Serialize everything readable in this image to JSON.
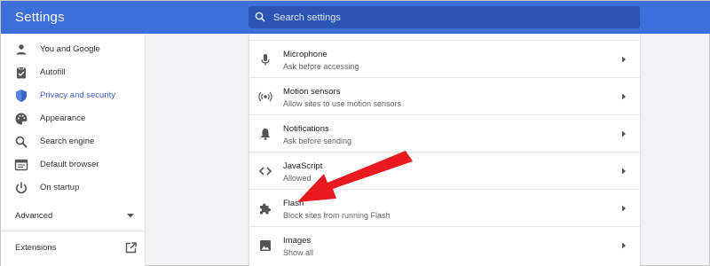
{
  "header": {
    "title": "Settings",
    "search_placeholder": "Search settings",
    "search_icon": "search-icon"
  },
  "sidebar": {
    "items": [
      {
        "label": "You and Google",
        "icon": "person-icon",
        "active": false
      },
      {
        "label": "Autofill",
        "icon": "clipboard-icon",
        "active": false
      },
      {
        "label": "Privacy and security",
        "icon": "shield-icon",
        "active": true
      },
      {
        "label": "Appearance",
        "icon": "palette-icon",
        "active": false
      },
      {
        "label": "Search engine",
        "icon": "search-icon",
        "active": false
      },
      {
        "label": "Default browser",
        "icon": "browser-icon",
        "active": false
      },
      {
        "label": "On startup",
        "icon": "power-icon",
        "active": false
      }
    ],
    "advanced_label": "Advanced",
    "extensions_label": "Extensions"
  },
  "content": {
    "rows": [
      {
        "title": "Microphone",
        "subtitle": "Ask before accessing",
        "icon": "microphone-icon"
      },
      {
        "title": "Motion sensors",
        "subtitle": "Allow sites to use motion sensors",
        "icon": "sensors-icon"
      },
      {
        "title": "Notifications",
        "subtitle": "Ask before sending",
        "icon": "bell-icon"
      },
      {
        "title": "JavaScript",
        "subtitle": "Allowed",
        "icon": "code-icon"
      },
      {
        "title": "Flash",
        "subtitle": "Block sites from running Flash",
        "icon": "puzzle-icon"
      },
      {
        "title": "Images",
        "subtitle": "Show all",
        "icon": "image-icon"
      }
    ]
  },
  "annotation": {
    "arrow_color": "#e8191f",
    "points_to": "Flash"
  },
  "colors": {
    "header": "#3c6fd8",
    "search_box": "#2a55b2",
    "active_nav": "#3b64c6"
  }
}
